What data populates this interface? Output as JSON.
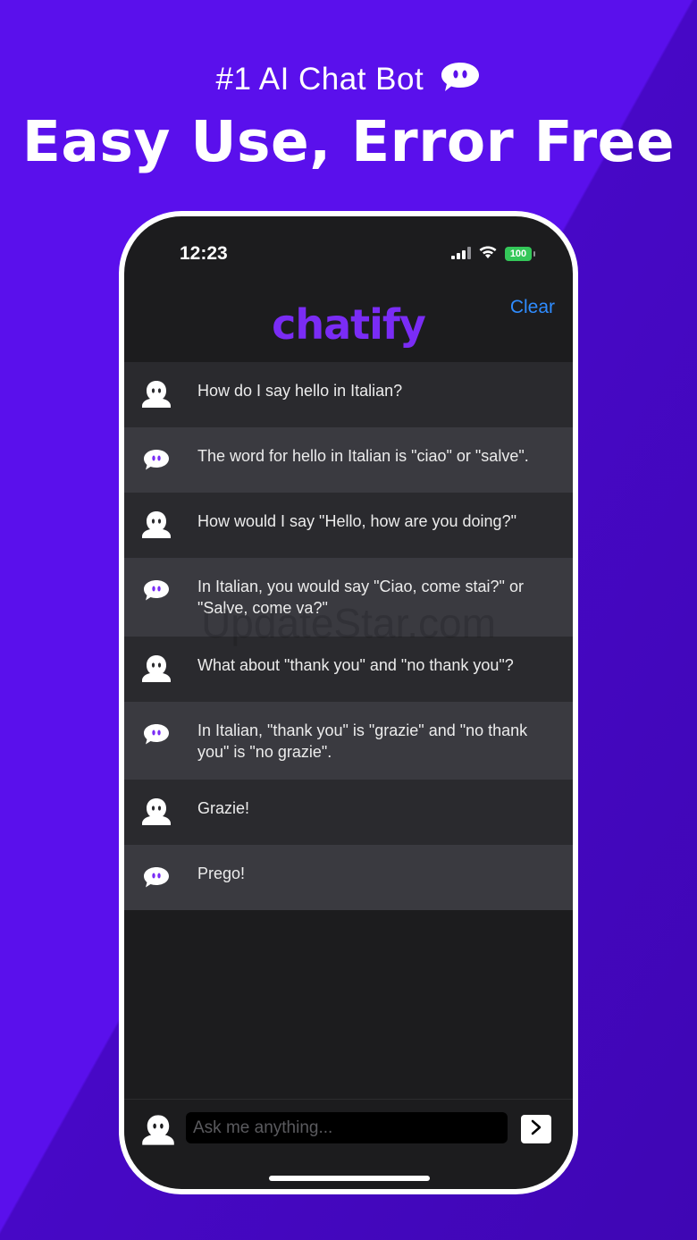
{
  "hero": {
    "subtitle": "#1 AI Chat Bot",
    "title": "Easy Use, Error Free"
  },
  "status_bar": {
    "time": "12:23",
    "battery": "100"
  },
  "header": {
    "clear_label": "Clear",
    "logo_text": "chatify"
  },
  "messages": [
    {
      "role": "user",
      "text": "How do I say hello in Italian?"
    },
    {
      "role": "bot",
      "text": "The word for hello in Italian is \"ciao\" or \"salve\"."
    },
    {
      "role": "user",
      "text": "How would I say \"Hello, how are you doing?\""
    },
    {
      "role": "bot",
      "text": "In Italian, you would say \"Ciao, come stai?\" or \"Salve, come va?\""
    },
    {
      "role": "user",
      "text": "What about \"thank you\" and \"no thank you\"?"
    },
    {
      "role": "bot",
      "text": "In Italian, \"thank you\" is \"grazie\" and \"no thank you\" is \"no grazie\"."
    },
    {
      "role": "user",
      "text": "Grazie!"
    },
    {
      "role": "bot",
      "text": "Prego!"
    }
  ],
  "input": {
    "placeholder": "Ask me anything..."
  },
  "watermark": "UpdateStar.com",
  "colors": {
    "background": "#5a10ec",
    "logo": "#7a2cf5",
    "clear": "#2f8cff",
    "battery": "#34c759"
  }
}
